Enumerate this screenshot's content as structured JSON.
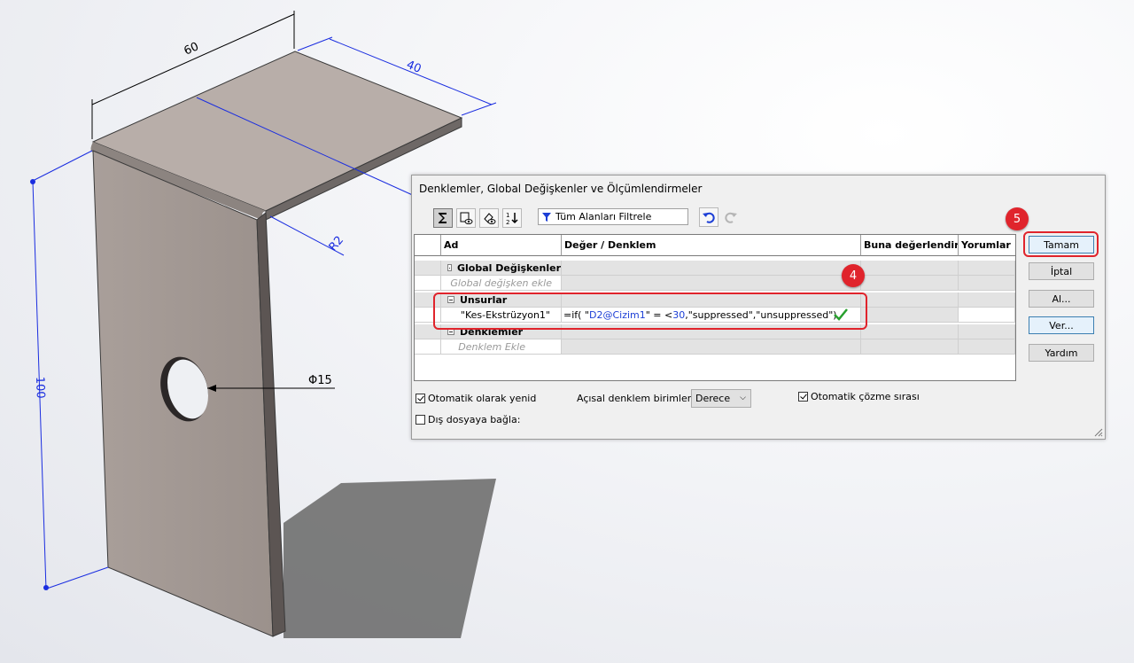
{
  "drawing": {
    "dim_width": "60",
    "dim_depth": "40",
    "dim_radius": "R2",
    "dim_height": "100",
    "dim_hole": "Φ15"
  },
  "dialog": {
    "title": "Denklemler, Global Değişkenler ve Ölçümlendirmeler",
    "filter_label": "Tüm Alanları Filtrele",
    "columns": [
      "Ad",
      "Değer / Denklem",
      "Buna değerlendir:",
      "Yorumlar"
    ],
    "rows": {
      "global_group": "Global Değişkenler",
      "global_placeholder": "Global değişken ekle",
      "features_group": "Unsurlar",
      "feature_name": "\"Kes-Ekstrüzyon1\"",
      "eq_prefix": "=if( \"",
      "eq_var": "D2@Cizim1",
      "eq_mid1": "\" = <",
      "eq_num": "30",
      "eq_suffix": " ,\"suppressed\",\"unsuppressed\")",
      "equations_group": "Denklemler",
      "equations_placeholder": "Denklem Ekle"
    },
    "buttons": {
      "ok": "Tamam",
      "cancel": "İptal",
      "import": "Al...",
      "export": "Ver...",
      "help": "Yardım"
    },
    "options": {
      "auto_rebuild": "Otomatik olarak yenid",
      "auto_rebuild_checked": true,
      "link_external": "Dış dosyaya bağla:",
      "link_external_checked": false,
      "angle_units_label": "Açısal denklem birimleri:",
      "angle_units_value": "Derece",
      "auto_solve": "Otomatik çözme sırası",
      "auto_solve_checked": true
    }
  },
  "annotations": {
    "step4": "4",
    "step5": "5"
  },
  "colors": {
    "highlight": "#e0242c",
    "dimension_line": "#1a2de0",
    "part_face": "#b8aea9"
  }
}
